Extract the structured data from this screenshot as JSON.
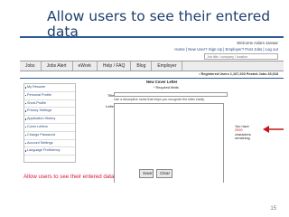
{
  "slide": {
    "title": "Allow users to see their entered data",
    "caption": "Allow users to see their entered data",
    "page_number": "15"
  },
  "header": {
    "welcome": "Welcome Aslam Janwar",
    "links": "Home | New User? Sign Up | Employer? Post Jobs | Log out",
    "search_placeholder": "Job title / company / location"
  },
  "nav": {
    "items": [
      "Jobs",
      "Jobs Alert",
      "eWork",
      "Help / FAQ",
      "Blog",
      "Employer"
    ]
  },
  "stats": {
    "text": "• Registered Users 1,167,203  Posted Jobs 33,018"
  },
  "sidebar": {
    "items": [
      "My Resume",
      "Personal Profile",
      "Short-Profile",
      "Privacy Settings",
      "Application History",
      "Cover Letters",
      "Change Password",
      "Account Settings",
      "Language Proficiency"
    ]
  },
  "form": {
    "title": "New Cover Letter",
    "required_note": "* Required fields",
    "title_label": "Title *",
    "title_value": "",
    "title_hint": "Use a descriptive name that helps you recognize the letter easily.",
    "letter_label": "Letter *",
    "letter_value": "",
    "counter_prefix": "You have",
    "counter_value": "2000",
    "counter_suffix": "characters remaining",
    "save_label": "Save",
    "clear_label": "Clear"
  },
  "colors": {
    "title": "#1b3f6e",
    "accent_rule": "#2e5c93",
    "arrow": "#c4161c",
    "caption": "#d4163c"
  }
}
